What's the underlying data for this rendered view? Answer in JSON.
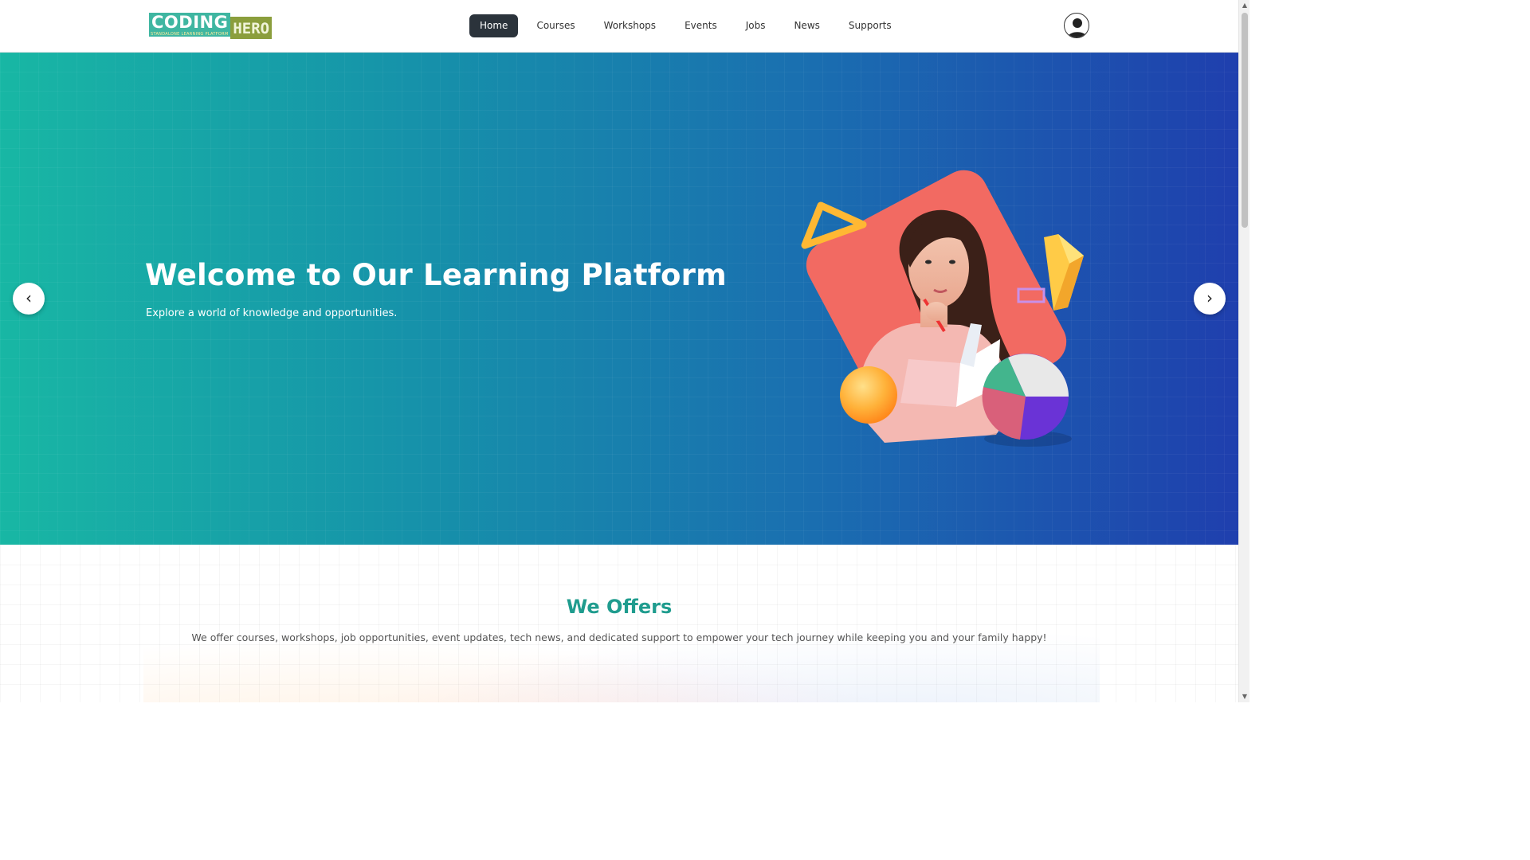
{
  "header": {
    "logo": {
      "main": "CODING",
      "accent": "HERO",
      "tagline": "STANDALONE LEARNING PLATFORM"
    },
    "nav": [
      {
        "label": "Home",
        "active": true
      },
      {
        "label": "Courses",
        "active": false
      },
      {
        "label": "Workshops",
        "active": false
      },
      {
        "label": "Events",
        "active": false
      },
      {
        "label": "Jobs",
        "active": false
      },
      {
        "label": "News",
        "active": false
      },
      {
        "label": "Supports",
        "active": false
      }
    ],
    "avatar_icon": "user-avatar-icon"
  },
  "hero": {
    "title": "Welcome to Our Learning Platform",
    "subtitle": "Explore a world of knowledge and opportunities.",
    "prev_label": "‹",
    "next_label": "›",
    "gradient_colors": [
      "#18b7a4",
      "#1690aa",
      "#1a6fb0",
      "#1f3fae"
    ]
  },
  "offers": {
    "title": "We Offers",
    "description": "We offer courses, workshops, job opportunities, event updates, tech news, and dedicated support to empower your tech journey while keeping you and your family happy!",
    "title_color": "#1f9c8e"
  },
  "colors": {
    "nav_active_bg": "#2b333b",
    "logo_teal": "#3fb6a1",
    "logo_olive": "#8b9e3c"
  }
}
